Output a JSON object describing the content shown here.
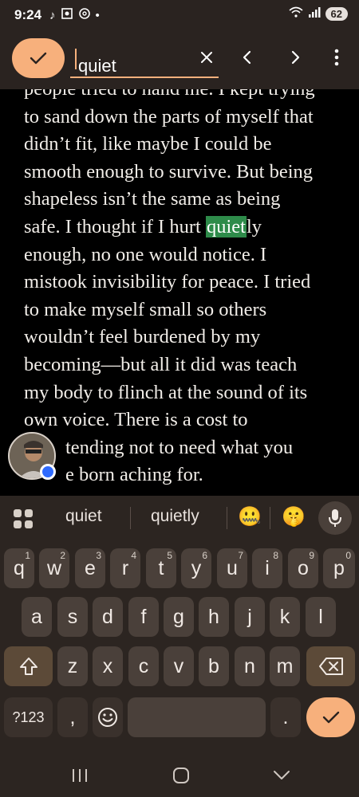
{
  "status": {
    "time": "9:24",
    "battery": "62",
    "left_icons": [
      "tiktok-icon",
      "screen-record-icon",
      "threads-icon",
      "dot-icon"
    ],
    "right_icons": [
      "wifi-icon",
      "signal-icon"
    ]
  },
  "find_bar": {
    "query": "quiet",
    "confirm_icon": "check-icon",
    "clear_icon": "close-icon",
    "prev_icon": "chevron-left-icon",
    "next_icon": "chevron-right-icon",
    "menu_icon": "more-vert-icon"
  },
  "reader": {
    "lines": [
      "people tried to hand me. I kept trying",
      "to sand down the parts of myself that",
      "didn’t fit, like maybe I could be",
      "smooth enough to survive. But being",
      "shapeless isn’t the same as being",
      "enough, no one would notice. I",
      "mistook invisibility for peace. I tried",
      "to make myself small so others",
      "wouldn’t feel burdened by my",
      "becoming—but all it did was teach",
      "my body to flinch at the sound of its",
      "own voice. There is a cost to",
      "tending not to need what you",
      "e born aching for."
    ],
    "match_line_prefix": "safe. I thought if I hurt ",
    "match_text": "quiet",
    "match_line_suffix": "ly"
  },
  "suggestions": {
    "items": [
      "quiet",
      "quietly"
    ],
    "emoji_1": "🤐",
    "emoji_2": "🤫",
    "apps_icon": "grid-icon",
    "mic_icon": "mic-icon"
  },
  "keyboard": {
    "row1": [
      [
        "q",
        "1"
      ],
      [
        "w",
        "2"
      ],
      [
        "e",
        "3"
      ],
      [
        "r",
        "4"
      ],
      [
        "t",
        "5"
      ],
      [
        "y",
        "6"
      ],
      [
        "u",
        "7"
      ],
      [
        "i",
        "8"
      ],
      [
        "o",
        "9"
      ],
      [
        "p",
        "0"
      ]
    ],
    "row2": [
      "a",
      "s",
      "d",
      "f",
      "g",
      "h",
      "j",
      "k",
      "l"
    ],
    "row3": [
      "z",
      "x",
      "c",
      "v",
      "b",
      "n",
      "m"
    ],
    "sym_label": "?123",
    "comma": ",",
    "period": ".",
    "shift_icon": "shift-icon",
    "backspace_icon": "backspace-icon",
    "emoji_icon": "emoji-icon",
    "enter_icon": "check-icon"
  },
  "nav": {
    "recents_icon": "recents-icon",
    "home_icon": "home-icon",
    "back_icon": "back-chevron-icon"
  }
}
